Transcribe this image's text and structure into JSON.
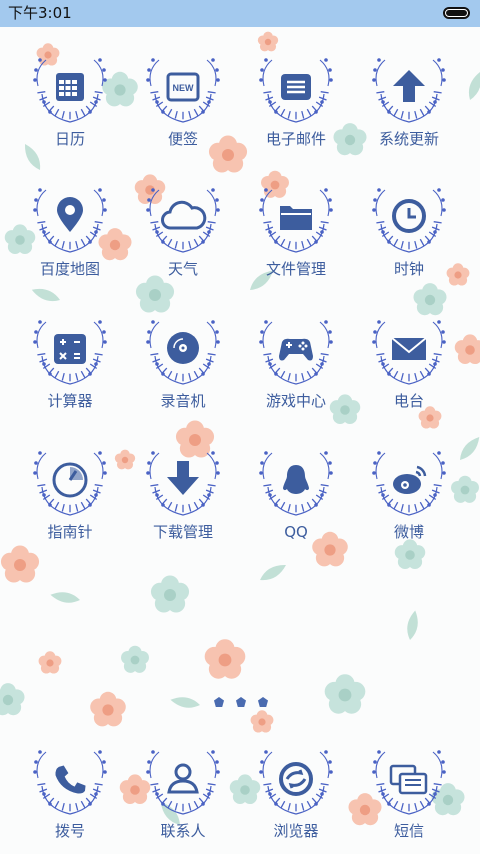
{
  "status_bar": {
    "time": "下午3:01"
  },
  "apps": [
    {
      "label": "日历",
      "icon": "calendar-icon"
    },
    {
      "label": "便签",
      "icon": "note-new-icon",
      "badge": "NEW"
    },
    {
      "label": "电子邮件",
      "icon": "email-icon"
    },
    {
      "label": "系统更新",
      "icon": "arrow-up-icon"
    },
    {
      "label": "百度地图",
      "icon": "map-pin-icon"
    },
    {
      "label": "天气",
      "icon": "cloud-icon"
    },
    {
      "label": "文件管理",
      "icon": "folder-icon"
    },
    {
      "label": "时钟",
      "icon": "clock-icon"
    },
    {
      "label": "计算器",
      "icon": "calculator-icon"
    },
    {
      "label": "录音机",
      "icon": "disc-icon"
    },
    {
      "label": "游戏中心",
      "icon": "gamepad-icon"
    },
    {
      "label": "电台",
      "icon": "envelope-icon"
    },
    {
      "label": "指南针",
      "icon": "compass-icon"
    },
    {
      "label": "下载管理",
      "icon": "arrow-down-icon"
    },
    {
      "label": "QQ",
      "icon": "penguin-icon"
    },
    {
      "label": "微博",
      "icon": "weibo-icon"
    }
  ],
  "dock": [
    {
      "label": "拨号",
      "icon": "phone-icon"
    },
    {
      "label": "联系人",
      "icon": "contact-icon"
    },
    {
      "label": "浏览器",
      "icon": "browser-icon"
    },
    {
      "label": "短信",
      "icon": "message-icon"
    }
  ],
  "pager": {
    "pages": 3
  },
  "colors": {
    "status_bar": "#a3c9ee",
    "icon": "#3d5d9e",
    "wreath": "#4a62c4",
    "flower_pink": "#f5b9a3",
    "flower_mint": "#b5dbd2"
  }
}
